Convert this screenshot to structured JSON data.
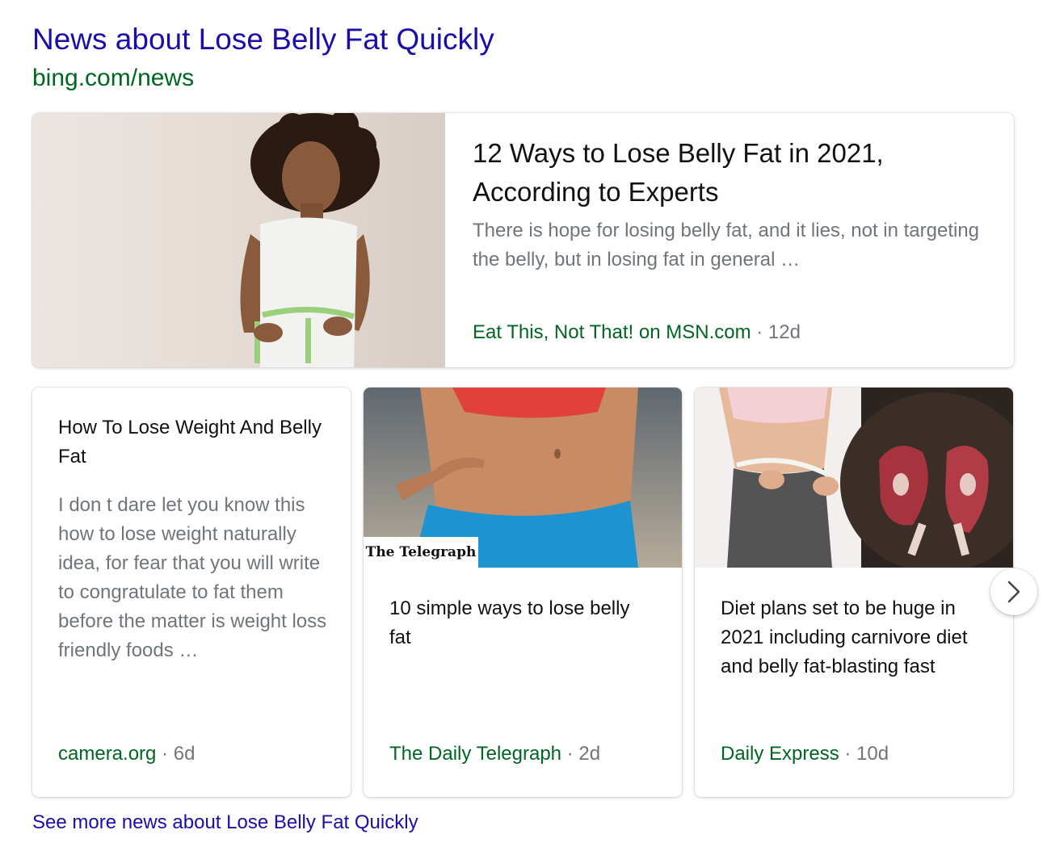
{
  "header": {
    "title": "News about Lose Belly Fat Quickly",
    "url": "bing.com/news"
  },
  "featured": {
    "title": "12 Ways to Lose Belly Fat in 2021, According to Experts",
    "snippet": "There is hope for losing belly fat, and it lies, not in targeting the belly, but in losing fat in general …",
    "source": "Eat This, Not That! on MSN.com",
    "age": " · 12d",
    "image": "woman-measuring-waist-photo"
  },
  "cards": [
    {
      "title": "How To Lose Weight And Belly Fat",
      "snippet": "I don t dare let you know this how to lose weight naturally idea, for fear that you will write to congratulate to fat them before the matter is weight loss friendly foods …",
      "source": "camera.org",
      "age": " · 6d"
    },
    {
      "title": "10 simple ways to lose belly fat",
      "source": "The Daily Telegraph",
      "age": " · 2d",
      "image": "waist-pinch-photo",
      "badge": "The Telegraph"
    },
    {
      "title": "Diet plans set to be huge in 2021 including carnivore diet and belly fat-blasting fast",
      "source": "Daily Express",
      "age": " · 10d",
      "image": "waist-tape-and-steaks-photo"
    }
  ],
  "see_more": "See more news about Lose Belly Fat Quickly",
  "icons": {
    "next": "chevron-right-icon"
  },
  "colors": {
    "link": "#1a0dab",
    "url": "#006621",
    "snippet": "#70757a"
  }
}
